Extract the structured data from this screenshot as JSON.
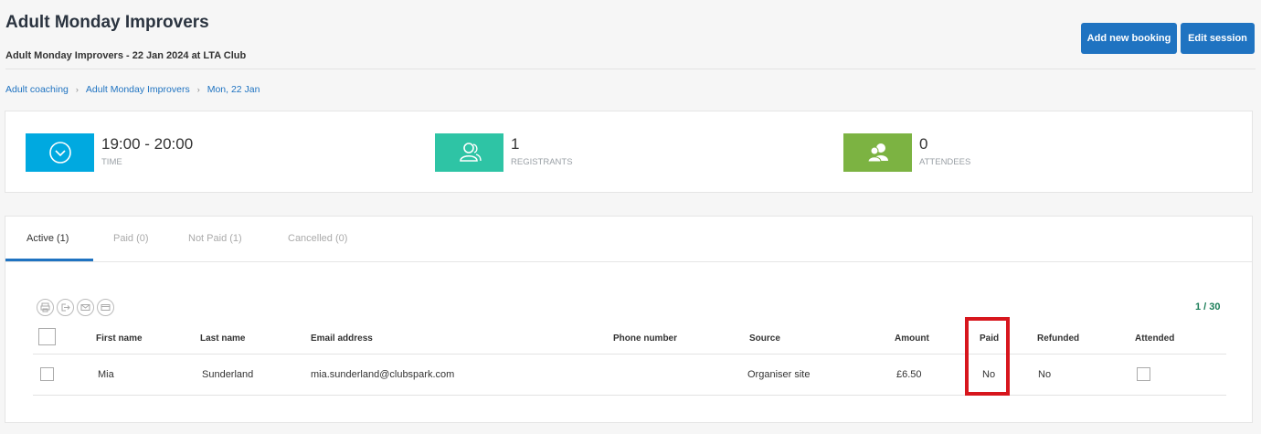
{
  "header": {
    "title": "Adult Monday Improvers",
    "subtitle": "Adult Monday Improvers - 22 Jan 2024 at LTA Club",
    "add_booking_label": "Add new booking",
    "edit_session_label": "Edit session"
  },
  "breadcrumb": {
    "items": [
      "Adult coaching",
      "Adult Monday Improvers",
      "Mon, 22 Jan"
    ],
    "separator": "›"
  },
  "stats": {
    "time": {
      "value": "19:00 - 20:00",
      "label": "TIME",
      "color": "#00a9e0",
      "icon": "clock-icon"
    },
    "registrants": {
      "value": "1",
      "label": "REGISTRANTS",
      "color": "#2ec4a5",
      "icon": "users-outline-icon"
    },
    "attendees": {
      "value": "0",
      "label": "ATTENDEES",
      "color": "#7cb342",
      "icon": "users-filled-icon"
    }
  },
  "tabs": [
    {
      "label": "Active (1)",
      "active": true
    },
    {
      "label": "Paid (0)",
      "active": false
    },
    {
      "label": "Not Paid (1)",
      "active": false
    },
    {
      "label": "Cancelled (0)",
      "active": false
    }
  ],
  "table": {
    "counter": "1 / 30",
    "action_icons": [
      "print-icon",
      "export-icon",
      "email-icon",
      "card-icon"
    ],
    "columns": {
      "first_name": "First name",
      "last_name": "Last name",
      "email": "Email address",
      "phone": "Phone number",
      "source": "Source",
      "amount": "Amount",
      "paid": "Paid",
      "refunded": "Refunded",
      "attended": "Attended"
    },
    "rows": [
      {
        "first_name": "Mia",
        "last_name": "Sunderland",
        "email": "mia.sunderland@clubspark.com",
        "phone": "",
        "source": "Organiser site",
        "amount": "£6.50",
        "paid": "No",
        "refunded": "No",
        "attended": false
      }
    ]
  },
  "colors": {
    "primary": "#1f73c1",
    "highlight": "#d7161d",
    "counter": "#1b7d58"
  }
}
